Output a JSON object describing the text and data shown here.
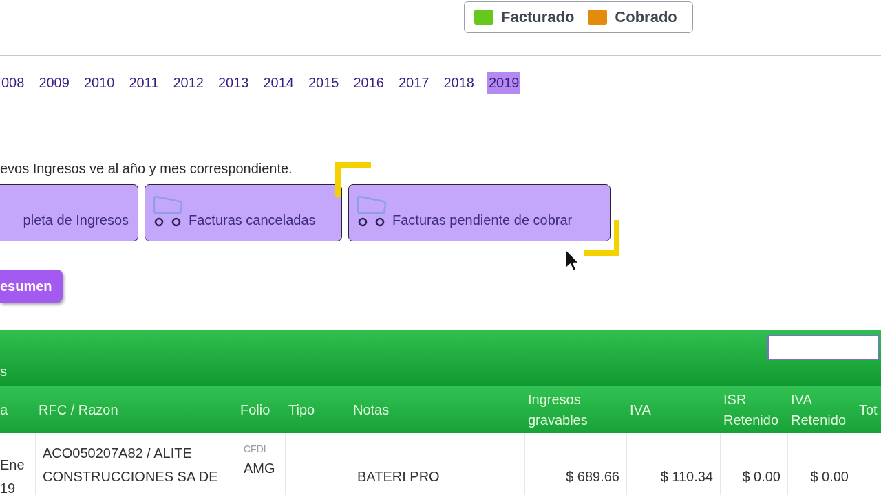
{
  "legend": [
    {
      "label": "Facturado",
      "color": "#66c71f"
    },
    {
      "label": "Cobrado",
      "color": "#e38b0a"
    }
  ],
  "years": [
    {
      "label": "008",
      "selected": false
    },
    {
      "label": "2009",
      "selected": false
    },
    {
      "label": "2010",
      "selected": false
    },
    {
      "label": "2011",
      "selected": false
    },
    {
      "label": "2012",
      "selected": false
    },
    {
      "label": "2013",
      "selected": false
    },
    {
      "label": "2014",
      "selected": false
    },
    {
      "label": "2015",
      "selected": false
    },
    {
      "label": "2016",
      "selected": false
    },
    {
      "label": "2017",
      "selected": false
    },
    {
      "label": "2018",
      "selected": false
    },
    {
      "label": "2019",
      "selected": true
    }
  ],
  "instruction": "evos Ingresos ve al año y mes correspondiente.",
  "actions": [
    {
      "label": "pleta de Ingresos",
      "kind": "text"
    },
    {
      "label": "Facturas canceladas",
      "kind": "cart"
    },
    {
      "label": "Facturas pendiente de cobrar",
      "kind": "cart"
    }
  ],
  "summary_button": "esumen",
  "table": {
    "title": "s",
    "columns": [
      "a",
      "RFC / Razon",
      "Folio",
      "Tipo",
      "Notas",
      "Ingresos gravables",
      "IVA",
      "ISR Retenido",
      "IVA Retenido",
      "Tot"
    ],
    "rows": [
      {
        "column_1": "Ene 19",
        "rfc_razon": "ACO050207A82 / ALITE CONSTRUCCIONES SA DE",
        "folio": {
          "label": "CFDI",
          "value": "AMG"
        },
        "notas": "BATERI PRO",
        "ingresos_gravables": "$ 689.66",
        "iva": "$ 110.34",
        "isr_retenido": "$ 0.00",
        "iva_retenido": "$ 0.00"
      }
    ]
  }
}
